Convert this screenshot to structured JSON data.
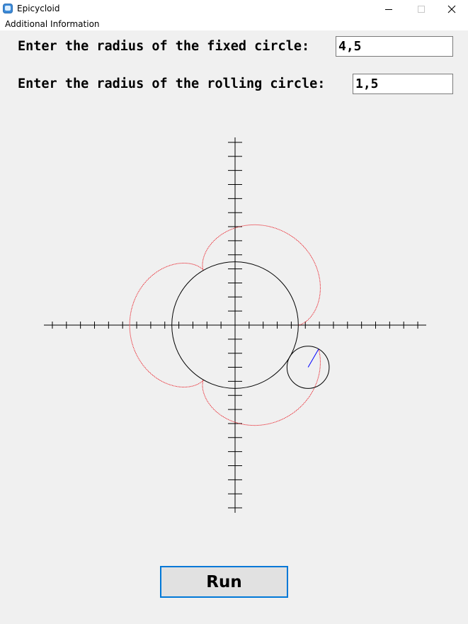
{
  "window": {
    "title": "Epicycloid",
    "icon": "app-icon",
    "controls": [
      "minimize-icon",
      "maximize-icon",
      "close-icon"
    ]
  },
  "menu": {
    "items": [
      "Additional Information"
    ]
  },
  "form": {
    "fixed_label": "Enter the radius of the fixed circle:",
    "fixed_value": "4,5",
    "rolling_label": "Enter the radius of the rolling circle:",
    "rolling_value": "1,5"
  },
  "plot": {
    "fixed_radius": 4.5,
    "rolling_radius": 1.5,
    "trace_end_angle_deg": 330,
    "colors": {
      "axes": "#000000",
      "fixed_circle": "#000000",
      "rolling_circle": "#000000",
      "trace": "#e8000b",
      "radius_line": "#0000ff"
    }
  },
  "run_label": "Run"
}
